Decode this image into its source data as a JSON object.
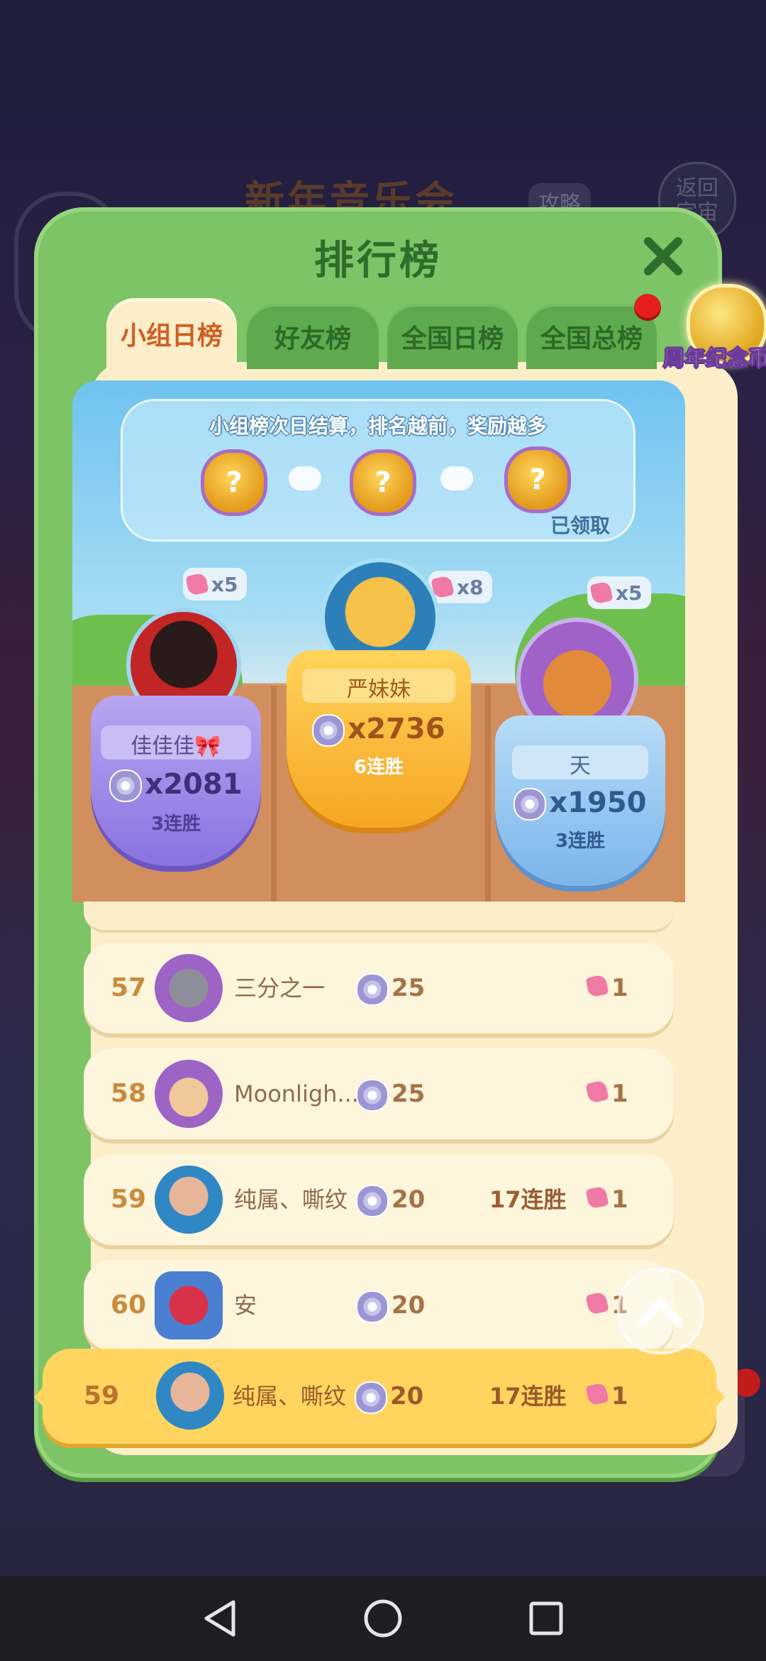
{
  "background": {
    "title": "新年音乐会",
    "tag": "攻略",
    "back_button": "返回\n宇宙"
  },
  "modal": {
    "title": "排行榜",
    "tabs": [
      {
        "label": "小组日榜",
        "active": true
      },
      {
        "label": "好友榜",
        "active": false
      },
      {
        "label": "全国日榜",
        "active": false
      },
      {
        "label": "全国总榜",
        "active": false
      }
    ],
    "badge_label": "周年纪念币"
  },
  "reward": {
    "text": "小组榜次日结算，排名越前，奖励越多",
    "chest_symbol": "?",
    "claimed": "已领取"
  },
  "podium": [
    {
      "place": 2,
      "name": "佳佳佳🎀",
      "score": "x2081",
      "streak": "3连胜",
      "gems": "x5"
    },
    {
      "place": 1,
      "name": "严妹妹",
      "score": "x2736",
      "streak": "6连胜",
      "gems": "x8"
    },
    {
      "place": 3,
      "name": "天",
      "score": "x1950",
      "streak": "3连胜",
      "gems": "x5"
    }
  ],
  "rows": [
    {
      "rank": "57",
      "name": "三分之一",
      "score": "25",
      "streak": "",
      "gems": "1"
    },
    {
      "rank": "58",
      "name": "Moonligh...",
      "score": "25",
      "streak": "",
      "gems": "1"
    },
    {
      "rank": "59",
      "name": "纯属、嘶纹",
      "score": "20",
      "streak": "17连胜",
      "gems": "1"
    },
    {
      "rank": "60",
      "name": "安",
      "score": "20",
      "streak": "",
      "gems": "1"
    }
  ],
  "self_row": {
    "rank": "59",
    "name": "纯属、嘶纹",
    "score": "20",
    "streak": "17连胜",
    "gems": "1"
  },
  "icons": {
    "close": "close-icon",
    "scroll_top": "chevron-up-icon",
    "nav_back": "back-triangle-icon",
    "nav_home": "home-circle-icon",
    "nav_recents": "recents-square-icon"
  },
  "colors": {
    "modal_green": "#7cc466",
    "tab_active_text": "#cf5f24",
    "self_row": "#ffd560"
  }
}
